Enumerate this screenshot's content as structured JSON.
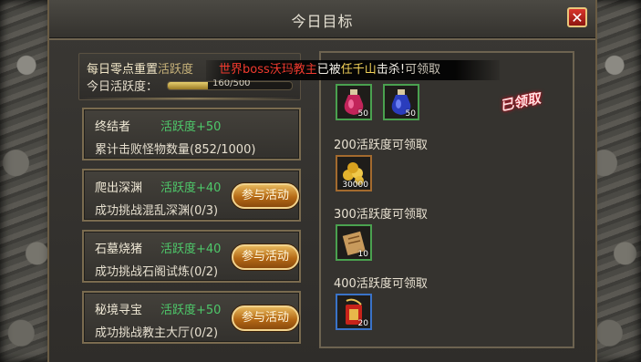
{
  "window": {
    "title": "今日目标",
    "close_label": "✕"
  },
  "summary": {
    "reset_prefix": "每日零点重置",
    "reset_highlight": "活跃度",
    "active_label": "今日活跃度：",
    "progress": {
      "current": 160,
      "max": 500,
      "text": "160/500"
    }
  },
  "tasks": [
    {
      "name": "终结者",
      "points": "活跃度+50",
      "desc": "累计击败怪物数量(852/1000)",
      "has_button": false
    },
    {
      "name": "爬出深渊",
      "points": "活跃度+40",
      "desc": "成功挑战混乱深渊(0/3)",
      "has_button": true,
      "button": "参与活动"
    },
    {
      "name": "石墓烧猪",
      "points": "活跃度+40",
      "desc": "成功挑战石阁试炼(0/2)",
      "has_button": true,
      "button": "参与活动"
    },
    {
      "name": "秘境寻宝",
      "points": "活跃度+50",
      "desc": "成功挑战教主大厅(0/2)",
      "has_button": true,
      "button": "参与活动"
    }
  ],
  "rewards": {
    "tier1": {
      "status": "已领取",
      "items": [
        {
          "icon": "red-potion-icon",
          "qty": "50"
        },
        {
          "icon": "blue-potion-icon",
          "qty": "50"
        }
      ]
    },
    "tier2": {
      "header": "200活跃度可领取",
      "items": [
        {
          "icon": "gold-coins-icon",
          "qty": "30000"
        }
      ]
    },
    "tier3": {
      "header": "300活跃度可领取",
      "items": [
        {
          "icon": "scroll-icon",
          "qty": "10"
        }
      ]
    },
    "tier4": {
      "header": "400活跃度可领取",
      "items": [
        {
          "icon": "talisman-icon",
          "qty": "20"
        }
      ]
    }
  },
  "broadcast": {
    "part1": "世界boss",
    "part2": "沃玛教主",
    "part3": "已被",
    "part4": "任千山",
    "part5": "击杀!",
    "trail": "可领取"
  },
  "colors": {
    "accent_green": "#4ec86a",
    "broadcast_red": "#f03a2e",
    "button_orange": "#b56a16"
  }
}
